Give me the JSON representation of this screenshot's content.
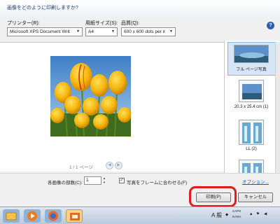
{
  "header": {
    "text": "画像をどのように印刷しますか?"
  },
  "printer": {
    "label": "プリンター(R):",
    "value": "Microsoft XPS Document Writ"
  },
  "paper": {
    "label": "用紙サイズ(S):",
    "value": "A4"
  },
  "quality": {
    "label": "品質(Q):",
    "value": "600 x 600 dots per ir"
  },
  "pager": {
    "text": "1 / 1 ページ"
  },
  "layouts": [
    {
      "label": "フル ページ写真"
    },
    {
      "label": "20.3 x 25.4 cm (1)"
    },
    {
      "label": "LL (2)"
    },
    {
      "label": ""
    }
  ],
  "options_link": "オプション...",
  "copies": {
    "label": "各画像の部数(C):",
    "value": "1"
  },
  "fit": {
    "label": "写真をフレームに合わせる(F)",
    "checked": true
  },
  "buttons": {
    "print": "印刷(P)",
    "cancel": "キャンセル"
  },
  "taskbar": {
    "lang": "A 般",
    "caps": "CAPS",
    "kana": "KANA"
  },
  "colors": {
    "highlight": "#e01b1b",
    "link": "#0b5cc6"
  }
}
